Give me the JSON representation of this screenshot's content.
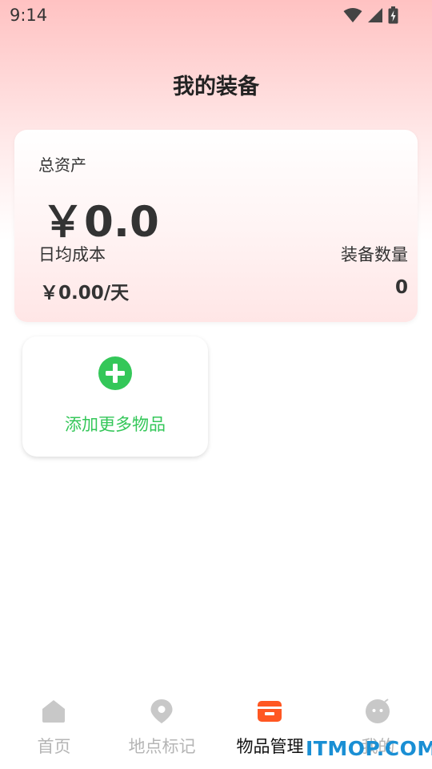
{
  "status_bar": {
    "time": "9:14",
    "icons": [
      "wifi-icon",
      "cellular-signal-icon",
      "battery-charging-icon"
    ]
  },
  "header": {
    "title": "我的装备"
  },
  "summary_card": {
    "total_assets_label": "总资产",
    "total_assets_value": "￥0.0",
    "daily_cost_label": "日均成本",
    "daily_cost_value": "￥0.00/天",
    "item_count_label": "装备数量",
    "item_count_value": "0"
  },
  "add_item": {
    "label": "添加更多物品",
    "icon": "plus-circle-icon",
    "color": "#34c759"
  },
  "tab_bar": {
    "active_color": "#ff5722",
    "inactive_color": "#c8c8c8",
    "tabs": [
      {
        "label": "首页",
        "icon": "home-icon",
        "active": false
      },
      {
        "label": "地点标记",
        "icon": "location-pin-icon",
        "active": false
      },
      {
        "label": "物品管理",
        "icon": "item-box-icon",
        "active": true
      },
      {
        "label": "我的",
        "icon": "profile-face-icon",
        "active": false
      }
    ]
  },
  "watermark": {
    "text": "ITMOP.COM"
  }
}
